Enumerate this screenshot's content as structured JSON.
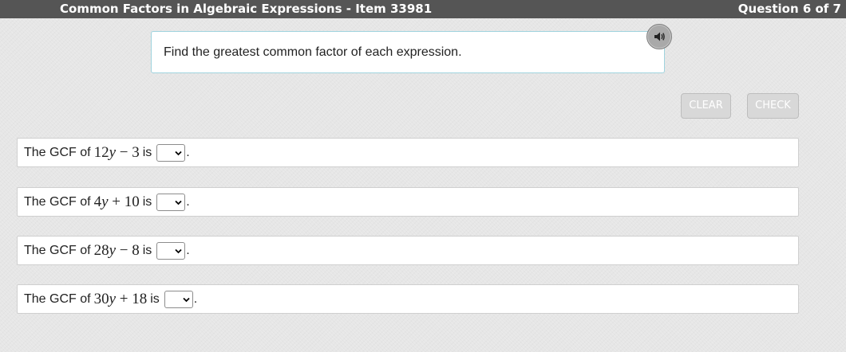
{
  "header": {
    "title": "Common Factors in Algebraic Expressions - Item 33981",
    "question_counter": "Question 6 of 7"
  },
  "instruction": {
    "text": "Find the greatest common factor of each expression."
  },
  "icons": {
    "speaker": "speaker-icon",
    "dropdown": "chevron-down-icon"
  },
  "buttons": {
    "clear": "CLEAR",
    "check": "CHECK"
  },
  "rows": [
    {
      "prefix": "The GCF of",
      "coef": "12",
      "var": "y",
      "op": "−",
      "const": "3",
      "suffix": "is",
      "selected": "",
      "end": "."
    },
    {
      "prefix": "The GCF of",
      "coef": "4",
      "var": "y",
      "op": "+",
      "const": "10",
      "suffix": "is",
      "selected": "",
      "end": "."
    },
    {
      "prefix": "The GCF of",
      "coef": "28",
      "var": "y",
      "op": "−",
      "const": "8",
      "suffix": "is",
      "selected": "",
      "end": "."
    },
    {
      "prefix": "The GCF of",
      "coef": "30",
      "var": "y",
      "op": "+",
      "const": "18",
      "suffix": "is",
      "selected": "",
      "end": "."
    }
  ],
  "colors": {
    "header_bg": "#555555",
    "instruction_border": "#9fd3de",
    "button_disabled_bg": "#d8d8d8"
  }
}
